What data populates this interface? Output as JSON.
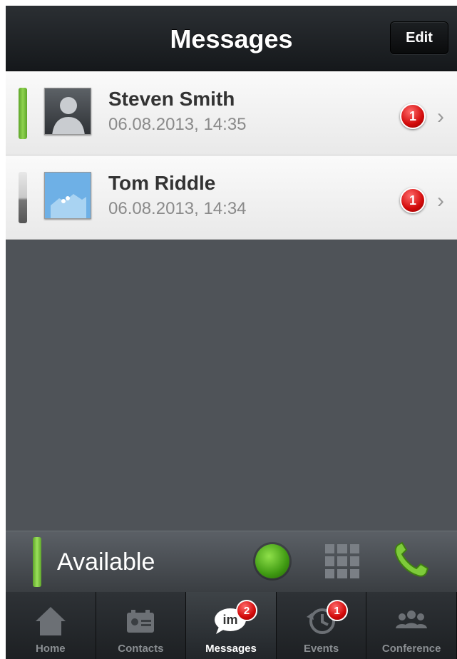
{
  "header": {
    "title": "Messages",
    "edit_label": "Edit"
  },
  "conversations": [
    {
      "name": "Steven Smith",
      "timestamp": "06.08.2013, 14:35",
      "unread": "1",
      "status": "online",
      "avatar": "default-avatar-icon"
    },
    {
      "name": "Tom Riddle",
      "timestamp": "06.08.2013, 14:34",
      "unread": "1",
      "status": "offline",
      "avatar": "photo-avatar"
    }
  ],
  "presence": {
    "label": "Available",
    "color": "#5ea52a"
  },
  "tabs": [
    {
      "label": "Home",
      "icon": "home-icon",
      "badge": null
    },
    {
      "label": "Contacts",
      "icon": "contacts-card-icon",
      "badge": null
    },
    {
      "label": "Messages",
      "icon": "im-bubble-icon",
      "badge": "2",
      "active": true
    },
    {
      "label": "Events",
      "icon": "history-clock-icon",
      "badge": "1"
    },
    {
      "label": "Conference",
      "icon": "conference-people-icon",
      "badge": null
    }
  ],
  "colors": {
    "badge_red": "#d20a0a",
    "online_green": "#5ea52a"
  }
}
